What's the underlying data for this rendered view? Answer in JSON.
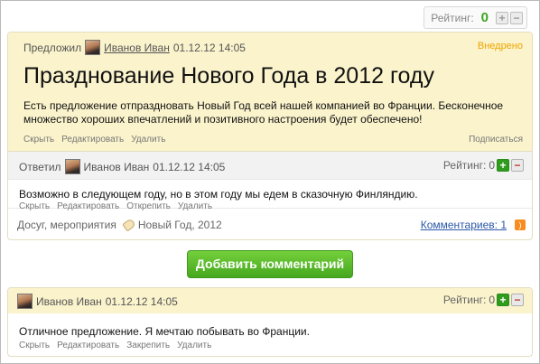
{
  "top_rating": {
    "label": "Рейтинг:",
    "value": "0",
    "plus": "+",
    "minus": "−"
  },
  "idea": {
    "proposed_label": "Предложил",
    "author": "Иванов Иван",
    "date": "01.12.12 14:05",
    "status": "Внедрено",
    "title": "Празднование Нового Года в 2012 году",
    "body": "Есть предложение отпраздновать Новый Год всей нашей компанией во Франции. Бесконечное множество хороших впечатлений и позитивного настроения будет обеспечено!",
    "actions": [
      "Скрыть",
      "Редактировать",
      "Удалить"
    ],
    "subscribe": "Подписаться"
  },
  "answer": {
    "label": "Ответил",
    "author": "Иванов Иван",
    "date": "01.12.12 14:05",
    "rating_label": "Рейтинг:",
    "rating_value": "0",
    "plus": "+",
    "minus": "−",
    "text": "Возможно в следующем году, но в этом году мы едем в сказочную Финляндию.",
    "actions": [
      "Скрыть",
      "Редактировать",
      "Открепить",
      "Удалить"
    ]
  },
  "tags": {
    "category": "Досуг, мероприятия",
    "tags": "Новый Год, 2012",
    "comments_link": "Комментариев: 1"
  },
  "add_comment_label": "Добавить комментарий",
  "comment": {
    "author": "Иванов Иван",
    "date": "01.12.12 14:05",
    "rating_label": "Рейтинг:",
    "rating_value": "0",
    "plus": "+",
    "minus": "−",
    "text": "Отличное предложение. Я мечтаю побывать во Франции.",
    "actions": [
      "Скрыть",
      "Редактировать",
      "Закрепить",
      "Удалить"
    ]
  },
  "colors": {
    "accent_green": "#39a51e",
    "status_orange": "#f0a500",
    "link_blue": "#2b58a8",
    "highlight_yellow": "#faf3cc"
  },
  "icons": {
    "avatar": "user-avatar",
    "tag": "tag-icon",
    "rss": "rss-icon"
  }
}
